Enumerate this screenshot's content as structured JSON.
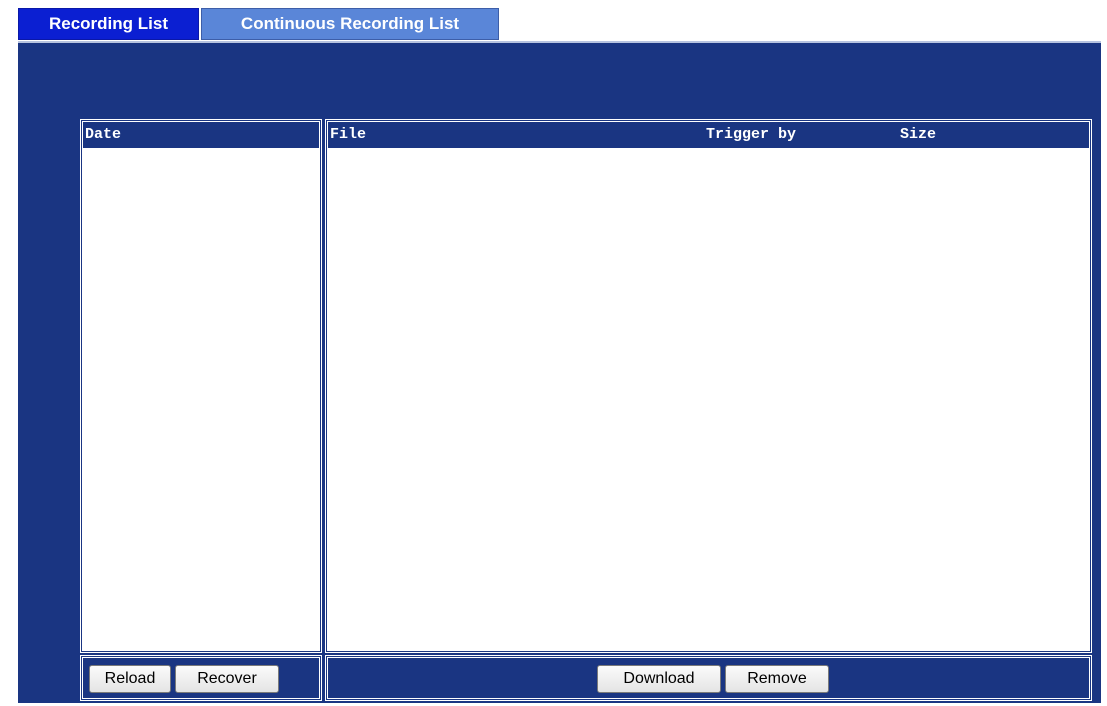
{
  "tabs": [
    {
      "label": "Recording List",
      "active": true
    },
    {
      "label": "Continuous Recording List",
      "active": false
    }
  ],
  "date_list": {
    "header": "Date",
    "items": []
  },
  "file_list": {
    "headers": {
      "file": "File",
      "trigger_by": "Trigger by",
      "size": "Size"
    },
    "items": []
  },
  "buttons": {
    "reload": "Reload",
    "recover": "Recover",
    "download": "Download",
    "remove": "Remove"
  },
  "colors": {
    "panel_bg": "#1a3582",
    "active_tab": "#0b1fd2",
    "inactive_tab": "#5a86d8",
    "list_bg": "#ffffff"
  }
}
